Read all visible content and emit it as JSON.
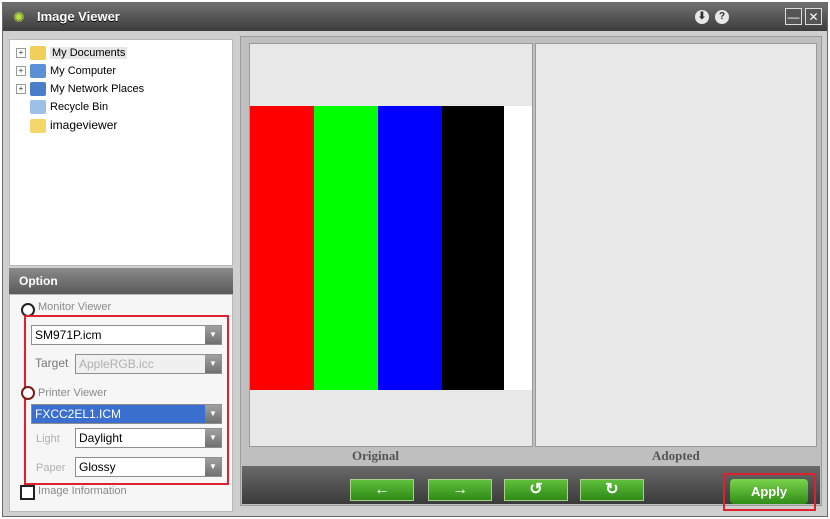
{
  "window": {
    "title": "Image Viewer",
    "download_icon": "⬇",
    "help_icon": "?",
    "minimize_icon": "—",
    "close_icon": "✕"
  },
  "tree": {
    "items": [
      {
        "label": "My Documents",
        "expander": "+"
      },
      {
        "label": "My Computer",
        "expander": "+"
      },
      {
        "label": "My Network Places",
        "expander": "+"
      },
      {
        "label": "Recycle Bin"
      },
      {
        "label": "imageviewer"
      }
    ]
  },
  "option": {
    "header": "Option",
    "monitor_viewer": {
      "label": "Monitor Viewer",
      "profile": "SM971P.icm",
      "target_label": "Target",
      "target": "AppleRGB.icc"
    },
    "printer_viewer": {
      "label": "Printer Viewer",
      "profile": "FXCC2EL1.ICM",
      "light_label": "Light",
      "light": "Daylight",
      "paper_label": "Paper",
      "paper": "Glossy"
    },
    "image_information": "Image Information"
  },
  "panes": {
    "original_label": "Original",
    "adopted_label": "Adopted"
  },
  "colors": {
    "bars": [
      "#ff0000",
      "#00ff00",
      "#0000ff",
      "#000000"
    ],
    "accent": "#2f8d16",
    "highlight_box": "#e0202a"
  },
  "toolbar": {
    "back_icon": "←",
    "forward_icon": "→",
    "rotate_left_icon": "↺",
    "rotate_right_icon": "↻",
    "apply_label": "Apply"
  }
}
